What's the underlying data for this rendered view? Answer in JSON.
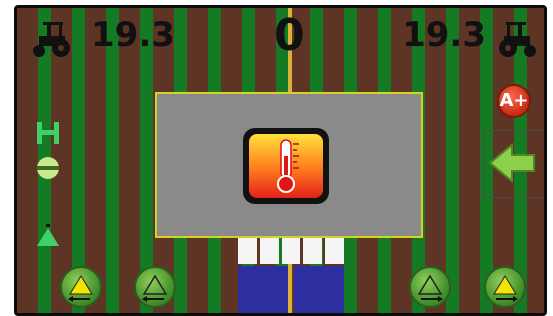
{
  "header": {
    "speed_left": "19.3",
    "center_value": "0",
    "speed_right": "19.3"
  },
  "icons": {
    "tractor_left": "tractor-icon",
    "tractor_right": "tractor-icon",
    "temperature": "thermometer-icon",
    "zoom": "a-plus-icon",
    "back": "left-arrow-icon",
    "boom": "boom-section-icon",
    "tilt": "tilt-icon"
  },
  "buttons": {
    "a_plus_label": "A+"
  },
  "colors": {
    "crop_row": "#157a24",
    "soil": "#5e3524",
    "guidance_line": "#d9b23a",
    "panel_bg": "#8a8a8a",
    "panel_border": "#d4d22a",
    "button_green": "#4fa32e",
    "marker_blue": "#2d2fa0"
  }
}
